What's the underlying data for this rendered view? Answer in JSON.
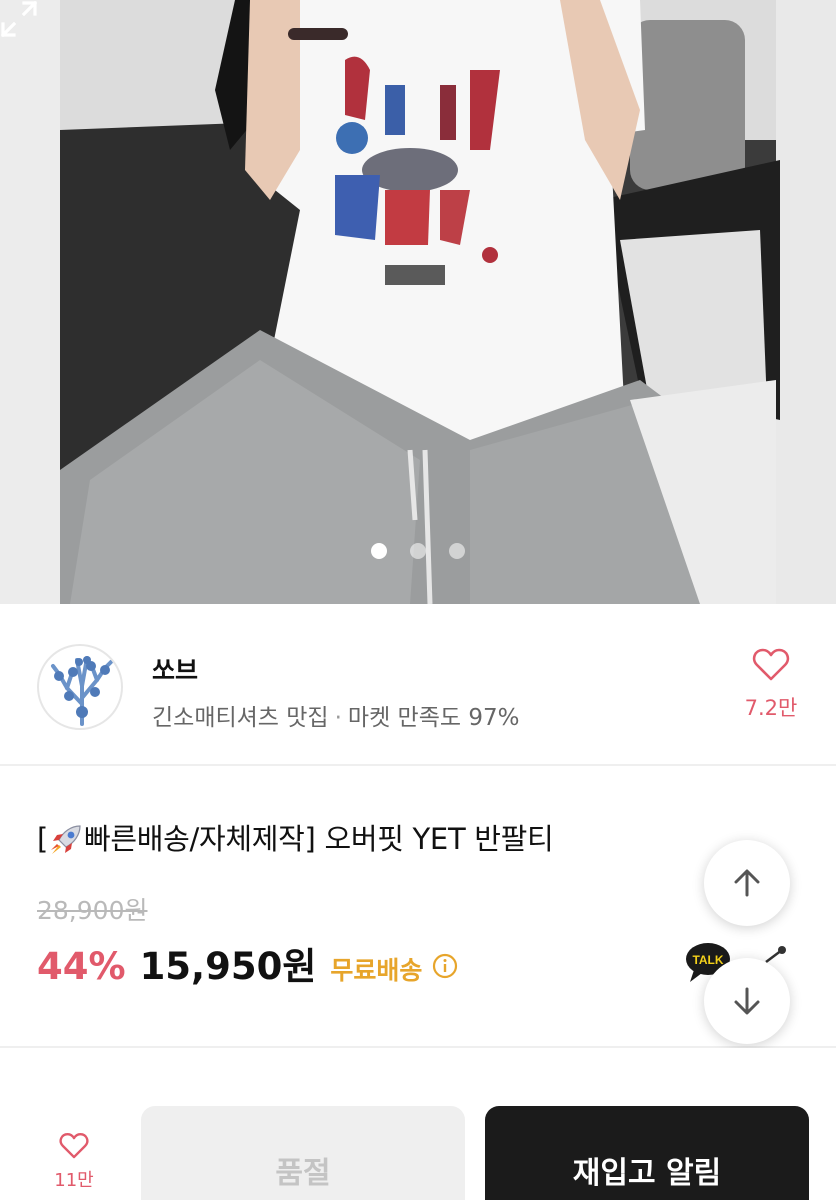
{
  "gallery": {
    "image_alt": "product photo",
    "dot_count": 3,
    "active_index": 0
  },
  "seller": {
    "name": "쏘브",
    "tagline": "긴소매티셔츠 맛집",
    "separator": "·",
    "satisfaction": "마켓 만족도 97%",
    "like_count": "7.2만"
  },
  "product": {
    "title_prefix": "[",
    "title_rest": "빠른배송/자체제작] 오버핏 YET 반팔티",
    "original_price": "28,900원",
    "discount": "44%",
    "price": "15,950원",
    "shipping": "무료배송"
  },
  "actions": {
    "talk_label": "TALK"
  },
  "bottom_bar": {
    "like_count": "11만",
    "soldout_label": "품절",
    "restock_label": "재입고 알림"
  },
  "colors": {
    "accent_red": "#e15a6b",
    "shipping_yellow": "#e7a52b",
    "primary_dark": "#1b1b1b"
  },
  "icons": [
    "expand-icon",
    "heart-icon",
    "rocket-icon",
    "info-icon",
    "talk-icon",
    "share-icon",
    "arrow-up-icon",
    "arrow-down-icon"
  ]
}
